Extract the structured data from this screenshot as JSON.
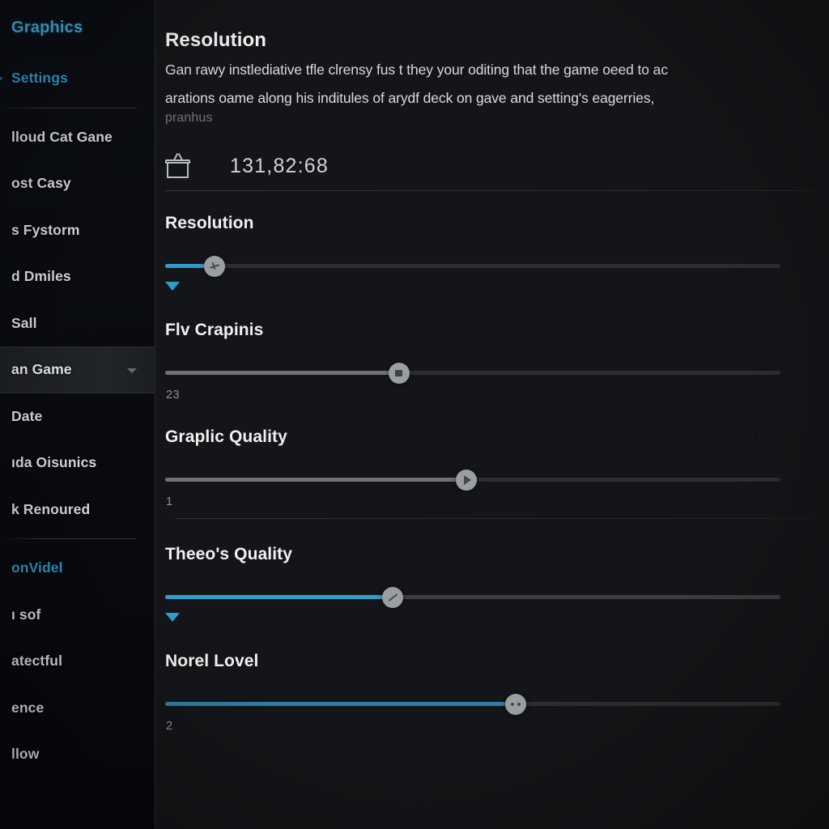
{
  "sidebar": {
    "brand": "Graphics",
    "nav_primary": {
      "label": "Settings",
      "icon": "chevron-right-icon"
    },
    "items": [
      {
        "label": "lloud Cat Gane",
        "state": "normal"
      },
      {
        "label": "ost Casy",
        "state": "normal"
      },
      {
        "label": "s Fystorm",
        "state": "normal"
      },
      {
        "label": "d Dmiles",
        "state": "normal"
      },
      {
        "label": "Sall",
        "state": "normal"
      },
      {
        "label": "an Game",
        "state": "selected",
        "icon": "chevron-down-icon"
      },
      {
        "label": "Date",
        "state": "normal"
      },
      {
        "label": "ıda Oisunics",
        "state": "normal"
      },
      {
        "label": "k Renoured",
        "state": "normal"
      }
    ],
    "items_lower": [
      {
        "label": "onVidel",
        "state": "link"
      },
      {
        "label": "ı sof",
        "state": "normal"
      },
      {
        "label": "atectful",
        "state": "normal"
      },
      {
        "label": "ence",
        "state": "normal"
      },
      {
        "label": "llow",
        "state": "normal"
      }
    ]
  },
  "main": {
    "title": "Resolution",
    "description_line1": "Gan rawy instlediative tfle clrensy fus t they your oditing that the game oeed to ac",
    "description_line2": "arations oame along his inditules of arydf deck on gave and setting's eagerries,",
    "subnote": "pranhus",
    "summary": {
      "icon": "gift-box-icon",
      "value": "131,82:68"
    },
    "settings": [
      {
        "label": "Resolution",
        "fill_percent": 8,
        "thumb_percent": 8,
        "fill_color": "#2f9ecb",
        "fill_style": "blue",
        "track_style": "dim",
        "thumb_glyph": "plane-icon",
        "below": {
          "type": "caret",
          "color": "#2f9ecb"
        },
        "divider_after": false
      },
      {
        "label": "Flv Crapinis",
        "fill_percent": 38,
        "thumb_percent": 38,
        "fill_color": "#6e7276",
        "fill_style": "grey",
        "track_style": "dim",
        "thumb_glyph": "stop-square-icon",
        "below": {
          "type": "value",
          "text": "23"
        },
        "divider_after": false
      },
      {
        "label": "Graplic Quality",
        "fill_percent": 49,
        "thumb_percent": 49,
        "fill_color": "#6e7276",
        "fill_style": "grey",
        "track_style": "dim",
        "thumb_glyph": "play-icon",
        "below": {
          "type": "value",
          "text": "1"
        },
        "divider_after": true
      },
      {
        "label": "Theeo's Quality",
        "fill_percent": 37,
        "thumb_percent": 37,
        "fill_color": "#2f9ecb",
        "fill_style": "blue",
        "track_style": "lit",
        "thumb_glyph": "slash-icon",
        "below": {
          "type": "caret",
          "color": "#2f9ecb"
        },
        "divider_after": false
      },
      {
        "label": "Norel Lovel",
        "fill_percent": 57,
        "thumb_percent": 57,
        "fill_color": "#2b7fa4",
        "fill_style": "blue",
        "track_style": "dim",
        "thumb_glyph": "two-dots-icon",
        "below": {
          "type": "value",
          "text": "2"
        },
        "divider_after": false
      }
    ]
  },
  "colors": {
    "accent_blue": "#2f9ecb",
    "brand_blue": "#3fa9d6",
    "panel_bg": "#141518",
    "sidebar_bg": "#0a0d13",
    "thumb_grey": "#9a9ea2",
    "track_grey": "#2c2e31",
    "text_primary": "#eef0f2",
    "text_muted": "#8d9297"
  }
}
